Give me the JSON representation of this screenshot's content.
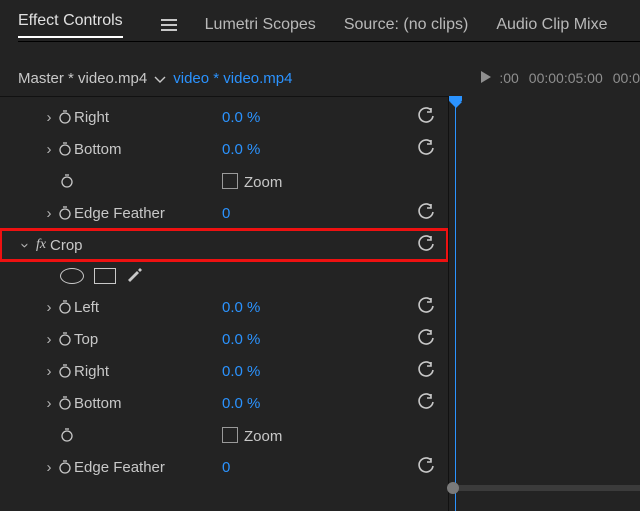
{
  "tabs": [
    "Effect Controls",
    "Lumetri Scopes",
    "Source: (no clips)",
    "Audio Clip Mixe"
  ],
  "activeTab": "Effect Controls",
  "header": {
    "master": "Master * video.mp4",
    "clip": "video * video.mp4"
  },
  "timecodes": [
    ":00",
    "00:00:05:00",
    "00:0"
  ],
  "effects": [
    {
      "rows": [
        {
          "kind": "prop",
          "name": "Right",
          "value": "0.0 %"
        },
        {
          "kind": "prop",
          "name": "Bottom",
          "value": "0.0 %"
        },
        {
          "kind": "zoom",
          "name": "Zoom"
        },
        {
          "kind": "prop",
          "name": "Edge Feather",
          "value": "0"
        }
      ]
    },
    {
      "title": "Crop",
      "highlighted": true,
      "rows": [
        {
          "kind": "prop",
          "name": "Left",
          "value": "0.0 %"
        },
        {
          "kind": "prop",
          "name": "Top",
          "value": "0.0 %"
        },
        {
          "kind": "prop",
          "name": "Right",
          "value": "0.0 %"
        },
        {
          "kind": "prop",
          "name": "Bottom",
          "value": "0.0 %"
        },
        {
          "kind": "zoom",
          "name": "Zoom"
        },
        {
          "kind": "prop",
          "name": "Edge Feather",
          "value": "0"
        }
      ]
    }
  ]
}
